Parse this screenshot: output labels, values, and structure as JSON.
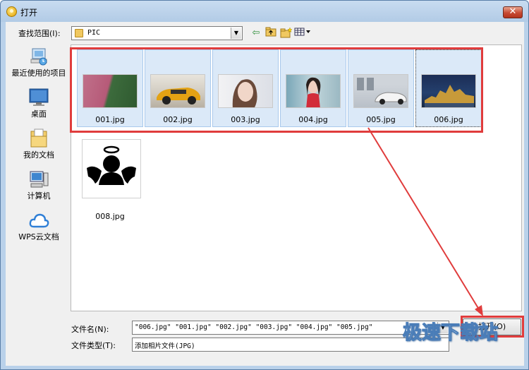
{
  "window": {
    "title": "打开",
    "close_label": "✕"
  },
  "toolbar": {
    "look_in_label": "查找范围(I):",
    "look_in_value": "PIC",
    "icons": [
      "back-arrow-icon",
      "up-folder-icon",
      "new-folder-icon",
      "view-menu-icon"
    ]
  },
  "places": [
    {
      "label": "最近使用的项目",
      "icon": "recent-icon"
    },
    {
      "label": "桌面",
      "icon": "desktop-icon"
    },
    {
      "label": "我的文档",
      "icon": "documents-icon"
    },
    {
      "label": "计算机",
      "icon": "computer-icon"
    },
    {
      "label": "WPS云文档",
      "icon": "cloud-icon"
    }
  ],
  "files": [
    {
      "name": "001.jpg",
      "selected": true
    },
    {
      "name": "002.jpg",
      "selected": true
    },
    {
      "name": "003.jpg",
      "selected": true
    },
    {
      "name": "004.jpg",
      "selected": true
    },
    {
      "name": "005.jpg",
      "selected": true
    },
    {
      "name": "006.jpg",
      "selected": true
    },
    {
      "name": "008.jpg",
      "selected": false
    }
  ],
  "bottom": {
    "filename_label": "文件名(N):",
    "filename_value": "\"006.jpg\" \"001.jpg\" \"002.jpg\" \"003.jpg\" \"004.jpg\" \"005.jpg\"",
    "filetype_label": "文件类型(T):",
    "filetype_value": "添加相片文件(JPG)",
    "open_label": "打开(O)"
  },
  "watermark": "极速下载站",
  "colors": {
    "highlight_red": "#e03c3c",
    "selection_bg": "#dbe9f8"
  }
}
